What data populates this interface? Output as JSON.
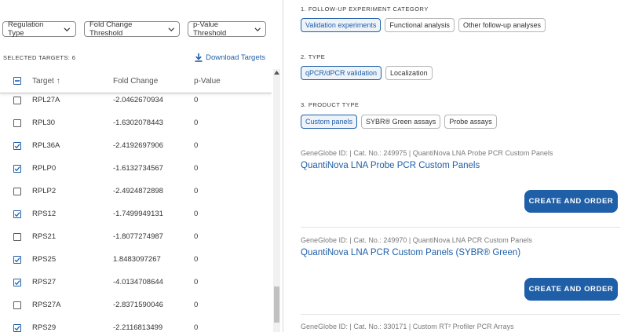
{
  "filters": {
    "regulation_type": "Regulation Type",
    "fold_change_threshold": "Fold Change Threshold",
    "p_value_threshold": "p-Value Threshold"
  },
  "selection": {
    "label": "SELECTED TARGETS: 6",
    "download": "Download Targets"
  },
  "table": {
    "headers": {
      "target": "Target",
      "target_sort": "↑",
      "fold_change": "Fold Change",
      "p_value": "p-Value"
    },
    "rows": [
      {
        "target": "RPL27A",
        "fold": "-2.0462670934",
        "p": "0",
        "checked": false
      },
      {
        "target": "RPL30",
        "fold": "-1.6302078443",
        "p": "0",
        "checked": false
      },
      {
        "target": "RPL36A",
        "fold": "-2.4192697906",
        "p": "0",
        "checked": true
      },
      {
        "target": "RPLP0",
        "fold": "-1.6132734567",
        "p": "0",
        "checked": true
      },
      {
        "target": "RPLP2",
        "fold": "-2.4924872898",
        "p": "0",
        "checked": false
      },
      {
        "target": "RPS12",
        "fold": "-1.7499949131",
        "p": "0",
        "checked": true
      },
      {
        "target": "RPS21",
        "fold": "-1.8077274987",
        "p": "0",
        "checked": false
      },
      {
        "target": "RPS25",
        "fold": "1.8483097267",
        "p": "0",
        "checked": true
      },
      {
        "target": "RPS27",
        "fold": "-4.0134708644",
        "p": "0",
        "checked": true
      },
      {
        "target": "RPS27A",
        "fold": "-2.8371590046",
        "p": "0",
        "checked": false
      },
      {
        "target": "RPS29",
        "fold": "-2.2116813499",
        "p": "0",
        "checked": true
      }
    ]
  },
  "sections": {
    "followup": {
      "title": "1. FOLLOW-UP EXPERIMENT CATEGORY",
      "options": [
        "Validation experiments",
        "Functional analysis",
        "Other follow-up analyses"
      ],
      "active": 0
    },
    "type": {
      "title": "2. TYPE",
      "options": [
        "qPCR/dPCR validation",
        "Localization"
      ],
      "active": 0
    },
    "product_type": {
      "title": "3. PRODUCT TYPE",
      "options": [
        "Custom panels",
        "SYBR® Green assays",
        "Probe assays"
      ],
      "active": 0
    }
  },
  "products": [
    {
      "meta": "GeneGlobe ID: | Cat. No.: 249975 | QuantiNova LNA Probe PCR Custom Panels",
      "name": "QuantiNova LNA Probe PCR Custom Panels",
      "cta": "CREATE AND ORDER"
    },
    {
      "meta": "GeneGlobe ID: | Cat. No.: 249970 | QuantiNova LNA PCR Custom Panels",
      "name": "QuantiNova LNA PCR Custom Panels (SYBR® Green)",
      "cta": "CREATE AND ORDER"
    },
    {
      "meta": "GeneGlobe ID: | Cat. No.: 330171 | Custom RT² Profiler PCR Arrays"
    }
  ],
  "colors": {
    "accent": "#1f5fa8",
    "border": "#b5b5b5"
  }
}
